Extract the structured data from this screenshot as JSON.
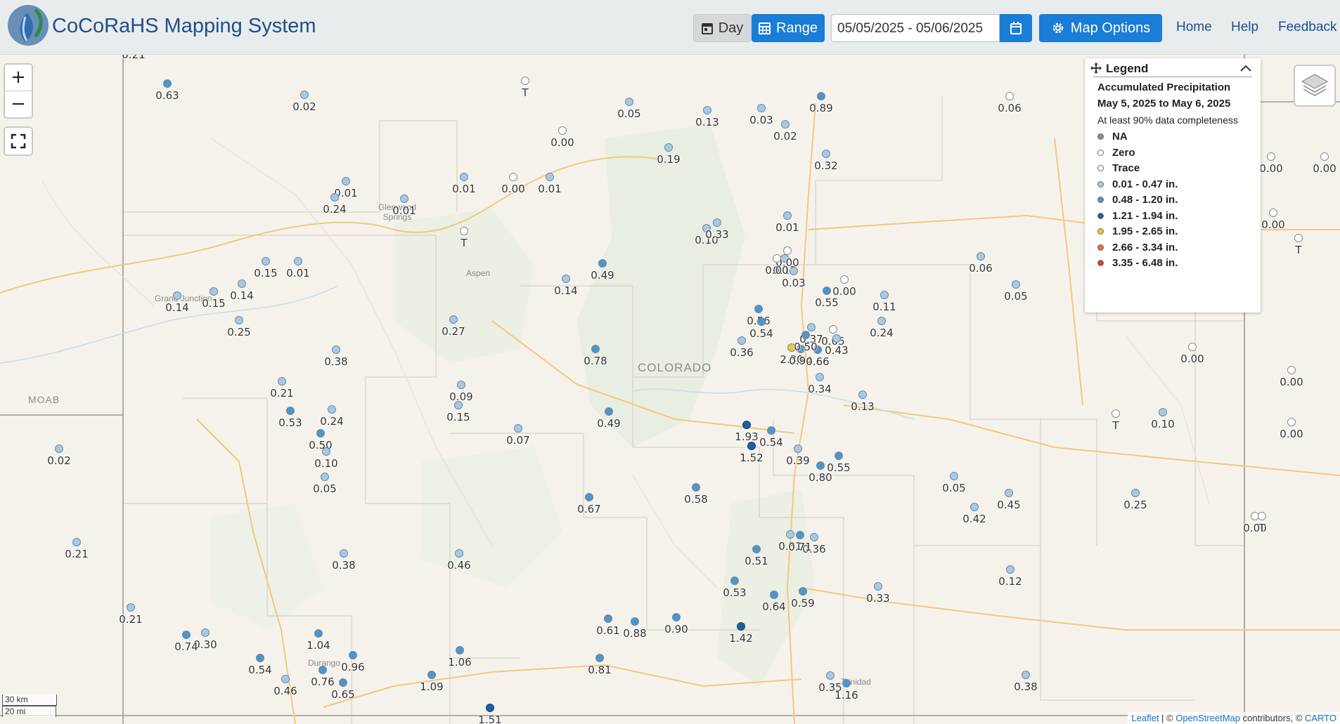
{
  "header": {
    "logo_text": "CoCoRaHS",
    "title": "CoCoRaHS Mapping System",
    "day_label": "Day",
    "range_label": "Range",
    "date_range": "05/05/2025 - 05/06/2025",
    "map_options_label": "Map Options",
    "nav": {
      "home": "Home",
      "help": "Help",
      "feedback": "Feedback"
    }
  },
  "colors": {
    "accent": "#1a7dd6",
    "title": "#1f4e8c"
  },
  "legend": {
    "title": "Legend",
    "heading": "Accumulated Precipitation",
    "period": "May 5, 2025 to May 6, 2025",
    "note": "At least 90% data completeness",
    "items": [
      {
        "label": "NA",
        "color": "#8c8c8c"
      },
      {
        "label": "Zero",
        "color": "#ffffff"
      },
      {
        "label": "Trace",
        "color": "#ffffff"
      },
      {
        "label": "0.01 - 0.47 in.",
        "color": "#a9c9e3"
      },
      {
        "label": "0.48 - 1.20 in.",
        "color": "#4f95c8"
      },
      {
        "label": "1.21 - 1.94 in.",
        "color": "#1f5fa8"
      },
      {
        "label": "1.95 - 2.65 in.",
        "color": "#f4c430"
      },
      {
        "label": "2.66 - 3.34 in.",
        "color": "#e8702a"
      },
      {
        "label": "3.35 - 6.48 in.",
        "color": "#d8412a"
      }
    ]
  },
  "map": {
    "state_labels": [
      "COLORADO",
      "MOAB"
    ],
    "places": [
      "Glenwood Springs",
      "Aspen",
      "Durango",
      "Trinidad",
      "Grand Junction"
    ],
    "scale": {
      "km": "30 km",
      "mi": "20 mi"
    },
    "attribution": {
      "leaflet": "Leaflet",
      "osm": "OpenStreetMap",
      "carto": "CARTO",
      "contrib": "contributors"
    },
    "stations": [
      {
        "v": "0.21",
        "c": 1
      },
      {
        "v": "0.63",
        "c": 2
      },
      {
        "v": "0.02",
        "c": 1
      },
      {
        "v": "T",
        "c": 0
      },
      {
        "v": "0.05",
        "c": 1
      },
      {
        "v": "0.00",
        "c": 0
      },
      {
        "v": "0.01",
        "c": 1
      },
      {
        "v": "0.24",
        "c": 1
      },
      {
        "v": "0.01",
        "c": 1
      },
      {
        "v": "0.01",
        "c": 1
      },
      {
        "v": "0.00",
        "c": 0
      },
      {
        "v": "0.01",
        "c": 1
      },
      {
        "v": "T",
        "c": 0
      },
      {
        "v": "0.15",
        "c": 1
      },
      {
        "v": "0.01",
        "c": 1
      },
      {
        "v": "0.14",
        "c": 1
      },
      {
        "v": "0.14",
        "c": 1
      },
      {
        "v": "0.15",
        "c": 1
      },
      {
        "v": "0.25",
        "c": 1
      },
      {
        "v": "0.27",
        "c": 1
      },
      {
        "v": "0.38",
        "c": 1
      },
      {
        "v": "0.21",
        "c": 1
      },
      {
        "v": "0.53",
        "c": 2
      },
      {
        "v": "0.24",
        "c": 1
      },
      {
        "v": "0.50",
        "c": 2
      },
      {
        "v": "0.10",
        "c": 1
      },
      {
        "v": "0.05",
        "c": 1
      },
      {
        "v": "0.02",
        "c": 1
      },
      {
        "v": "0.09",
        "c": 1
      },
      {
        "v": "0.15",
        "c": 1
      },
      {
        "v": "0.07",
        "c": 1
      },
      {
        "v": "0.49",
        "c": 2
      },
      {
        "v": "0.14",
        "c": 1
      },
      {
        "v": "0.49",
        "c": 2
      },
      {
        "v": "0.78",
        "c": 2
      },
      {
        "v": "0.21",
        "c": 1
      },
      {
        "v": "0.38",
        "c": 1
      },
      {
        "v": "0.46",
        "c": 1
      },
      {
        "v": "0.67",
        "c": 2
      },
      {
        "v": "0.58",
        "c": 2
      },
      {
        "v": "1.93",
        "c": 3
      },
      {
        "v": "1.52",
        "c": 3
      },
      {
        "v": "0.54",
        "c": 2
      },
      {
        "v": "0.39",
        "c": 1
      },
      {
        "v": "0.55",
        "c": 2
      },
      {
        "v": "0.51",
        "c": 2
      },
      {
        "v": "0.36",
        "c": 1
      },
      {
        "v": "0.53",
        "c": 2
      },
      {
        "v": "0.64",
        "c": 2
      },
      {
        "v": "0.59",
        "c": 2
      },
      {
        "v": "1.42",
        "c": 3
      },
      {
        "v": "0.90",
        "c": 2
      },
      {
        "v": "0.88",
        "c": 2
      },
      {
        "v": "0.61",
        "c": 2
      },
      {
        "v": "0.81",
        "c": 2
      },
      {
        "v": "1.06",
        "c": 2
      },
      {
        "v": "1.09",
        "c": 2
      },
      {
        "v": "1.51",
        "c": 3
      },
      {
        "v": "0.96",
        "c": 2
      },
      {
        "v": "0.76",
        "c": 2
      },
      {
        "v": "0.65",
        "c": 2
      },
      {
        "v": "1.04",
        "c": 2
      },
      {
        "v": "0.54",
        "c": 2
      },
      {
        "v": "0.46",
        "c": 1
      },
      {
        "v": "0.30",
        "c": 1
      },
      {
        "v": "0.74",
        "c": 2
      },
      {
        "v": "0.21",
        "c": 1
      },
      {
        "v": "0.19",
        "c": 1
      },
      {
        "v": "0.13",
        "c": 1
      },
      {
        "v": "0.02",
        "c": 1
      },
      {
        "v": "0.03",
        "c": 1
      },
      {
        "v": "0.01",
        "c": 1
      },
      {
        "v": "0.10",
        "c": 1
      },
      {
        "v": "0.33",
        "c": 1
      },
      {
        "v": "0.13",
        "c": 1
      },
      {
        "v": "0.06",
        "c": 1
      },
      {
        "v": "0.05",
        "c": 1
      },
      {
        "v": "0.55",
        "c": 2
      },
      {
        "v": "0.11",
        "c": 1
      },
      {
        "v": "0.24",
        "c": 1
      },
      {
        "v": "0.56",
        "c": 2
      },
      {
        "v": "0.36",
        "c": 1
      },
      {
        "v": "2.30",
        "c": 4
      },
      {
        "v": "0.34",
        "c": 1
      },
      {
        "v": "0.13",
        "c": 1
      },
      {
        "v": "0.00",
        "c": 0
      },
      {
        "v": "0.00",
        "c": 0
      },
      {
        "v": "0.00",
        "c": 0
      },
      {
        "v": "T",
        "c": 0
      },
      {
        "v": "0.00",
        "c": 0
      },
      {
        "v": "0.00",
        "c": 0
      },
      {
        "v": "0.00",
        "c": 0
      },
      {
        "v": "T",
        "c": 0
      },
      {
        "v": "0.10",
        "c": 1
      },
      {
        "v": "0.05",
        "c": 1
      },
      {
        "v": "0.42",
        "c": 1
      },
      {
        "v": "0.45",
        "c": 1
      },
      {
        "v": "0.25",
        "c": 1
      },
      {
        "v": "0.12",
        "c": 1
      },
      {
        "v": "0.33",
        "c": 1
      },
      {
        "v": "0.38",
        "c": 1
      },
      {
        "v": "0.35",
        "c": 1
      },
      {
        "v": "1.16",
        "c": 2
      },
      {
        "v": "0.89",
        "c": 2
      },
      {
        "v": "0.06",
        "c": 0
      },
      {
        "v": "0.05",
        "c": 0
      },
      {
        "v": "0.43",
        "c": 1
      },
      {
        "v": "0.37",
        "c": 1
      },
      {
        "v": "0.94",
        "c": 2
      },
      {
        "v": "0.66",
        "c": 2
      },
      {
        "v": "0.50",
        "c": 2
      },
      {
        "v": "0.54",
        "c": 2
      },
      {
        "v": "0.31",
        "c": 1
      },
      {
        "v": "0.71",
        "c": 2
      },
      {
        "v": "0.80",
        "c": 2
      },
      {
        "v": "0.32",
        "c": 1
      },
      {
        "v": "0.00",
        "c": 0
      },
      {
        "v": "0.00",
        "c": 0
      },
      {
        "v": "0.00",
        "c": 0
      },
      {
        "v": "0.03",
        "c": 1
      },
      {
        "v": "0.00",
        "c": 0
      },
      {
        "v": "T",
        "c": 0
      },
      {
        "v": "T",
        "c": 0
      }
    ]
  }
}
